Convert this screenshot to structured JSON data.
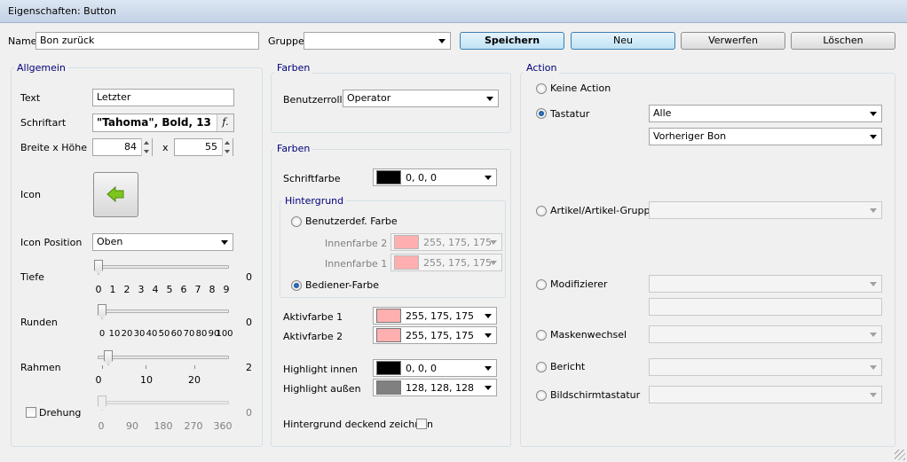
{
  "window": {
    "title": "Eigenschaften: Button"
  },
  "top": {
    "name_label": "Name",
    "name_value": "Bon zurück",
    "gruppe_label": "Gruppe",
    "gruppe_value": "",
    "buttons": {
      "save": "Speichern",
      "new": "Neu",
      "discard": "Verwerfen",
      "delete": "Löschen"
    }
  },
  "allgemein": {
    "legend": "Allgemein",
    "text_label": "Text",
    "text_value": "Letzter",
    "font_label": "Schriftart",
    "font_value": "\"Tahoma\", Bold, 13",
    "font_button": "f.",
    "size_label": "Breite x Höhe",
    "width": "84",
    "x_label": "x",
    "height": "55",
    "icon_label": "Icon",
    "icon_position_label": "Icon Position",
    "icon_position_value": "Oben",
    "tiefe": {
      "label": "Tiefe",
      "value": "0",
      "ticks": [
        "0",
        "1",
        "2",
        "3",
        "4",
        "5",
        "6",
        "7",
        "8",
        "9"
      ]
    },
    "runden": {
      "label": "Runden",
      "value": "0",
      "ticks": [
        "0",
        "10",
        "20",
        "30",
        "40",
        "50",
        "60",
        "70",
        "80",
        "90",
        "100"
      ]
    },
    "rahmen": {
      "label": "Rahmen",
      "value": "2",
      "ticks": [
        "0",
        "10",
        "20"
      ]
    },
    "drehung": {
      "label": "Drehung",
      "value": "0",
      "ticks": [
        "0",
        "90",
        "180",
        "270",
        "360"
      ]
    }
  },
  "farben1": {
    "legend": "Farben",
    "role_label": "Benutzerrolle",
    "role_value": "Operator"
  },
  "farben2": {
    "legend": "Farben",
    "fontcolor_label": "Schriftfarbe",
    "fontcolor_value": "0, 0, 0",
    "bg_legend": "Hintergrund",
    "custom_label": "Benutzerdef. Farbe",
    "inner2_label": "Innenfarbe 2",
    "inner2_value": "255, 175, 175",
    "inner1_label": "Innenfarbe 1",
    "inner1_value": "255, 175, 175",
    "operator_label": "Bediener-Farbe",
    "active1_label": "Aktivfarbe 1",
    "active1_value": "255, 175, 175",
    "active2_label": "Aktivfarbe 2",
    "active2_value": "255, 175, 175",
    "hl_inner_label": "Highlight innen",
    "hl_inner_value": "0, 0, 0",
    "hl_outer_label": "Highlight außen",
    "hl_outer_value": "128, 128, 128",
    "opaque_label": "Hintergrund deckend zeichnen"
  },
  "action": {
    "legend": "Action",
    "none_label": "Keine Action",
    "keyboard_label": "Tastatur",
    "keyboard_value": "Alle",
    "keyboard_value2": "Vorheriger Bon",
    "article_label": "Artikel/Artikel-Gruppe",
    "modifier_label": "Modifizierer",
    "mask_label": "Maskenwechsel",
    "report_label": "Bericht",
    "screenkbd_label": "Bildschirmtastatur"
  },
  "colors": {
    "pink": "#ffafaf",
    "black": "#000000",
    "gray": "#808080",
    "icon_arrow": "#7dc51f"
  },
  "icons": {
    "button_icon": "green-left-arrow-icon"
  }
}
